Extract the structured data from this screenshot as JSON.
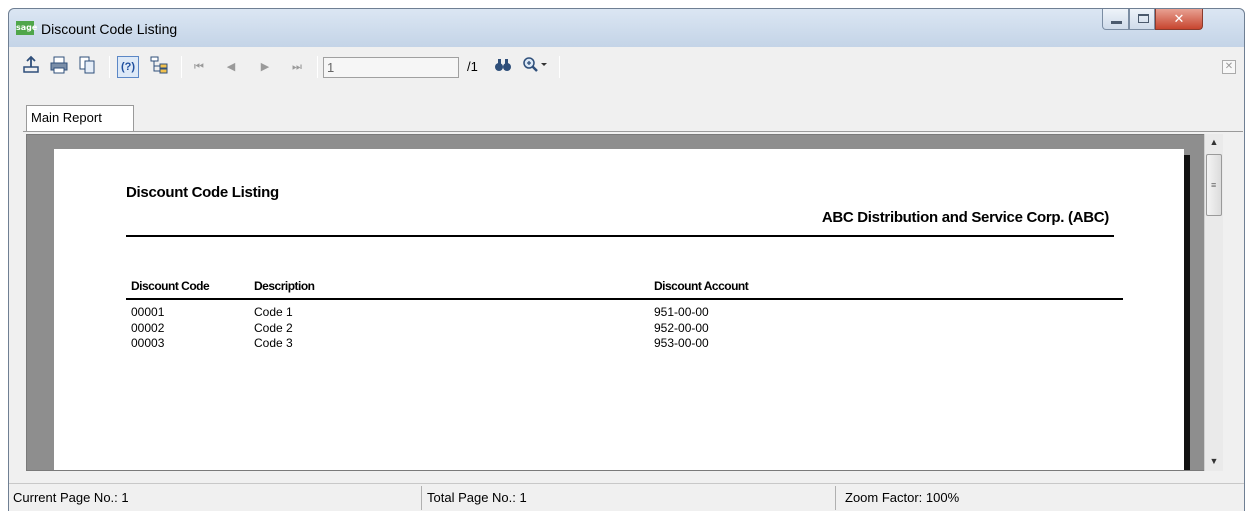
{
  "window": {
    "app_logo": "sage",
    "title": "Discount Code Listing",
    "controls": [
      "minimize-icon",
      "maximize-icon",
      "close-icon"
    ]
  },
  "toolbar": {
    "icons": [
      "export-icon",
      "print-icon",
      "copy-icon",
      "help-icon",
      "group-tree-icon",
      "first-page-icon",
      "prev-page-icon",
      "next-page-icon",
      "last-page-icon",
      "search-icon",
      "zoom-icon"
    ],
    "page_value": "1",
    "page_total": "/1"
  },
  "tabs": [
    {
      "label": "Main Report"
    }
  ],
  "report": {
    "title": "Discount Code Listing",
    "company": "ABC Distribution and Service Corp. (ABC)",
    "columns": [
      "Discount Code",
      "Description",
      "Discount Account"
    ],
    "rows": [
      {
        "code": "00001",
        "description": "Code 1",
        "account": "951-00-00"
      },
      {
        "code": "00002",
        "description": "Code 2",
        "account": "952-00-00"
      },
      {
        "code": "00003",
        "description": "Code 3",
        "account": "953-00-00"
      }
    ]
  },
  "status": {
    "current_page": "Current Page No.: 1",
    "total_page": "Total Page No.: 1",
    "zoom": "Zoom Factor: 100%"
  },
  "colors": {
    "titlebar": "#c4d4e7",
    "close_button": "#c7452f",
    "viewer_background": "#8e8e8e"
  }
}
